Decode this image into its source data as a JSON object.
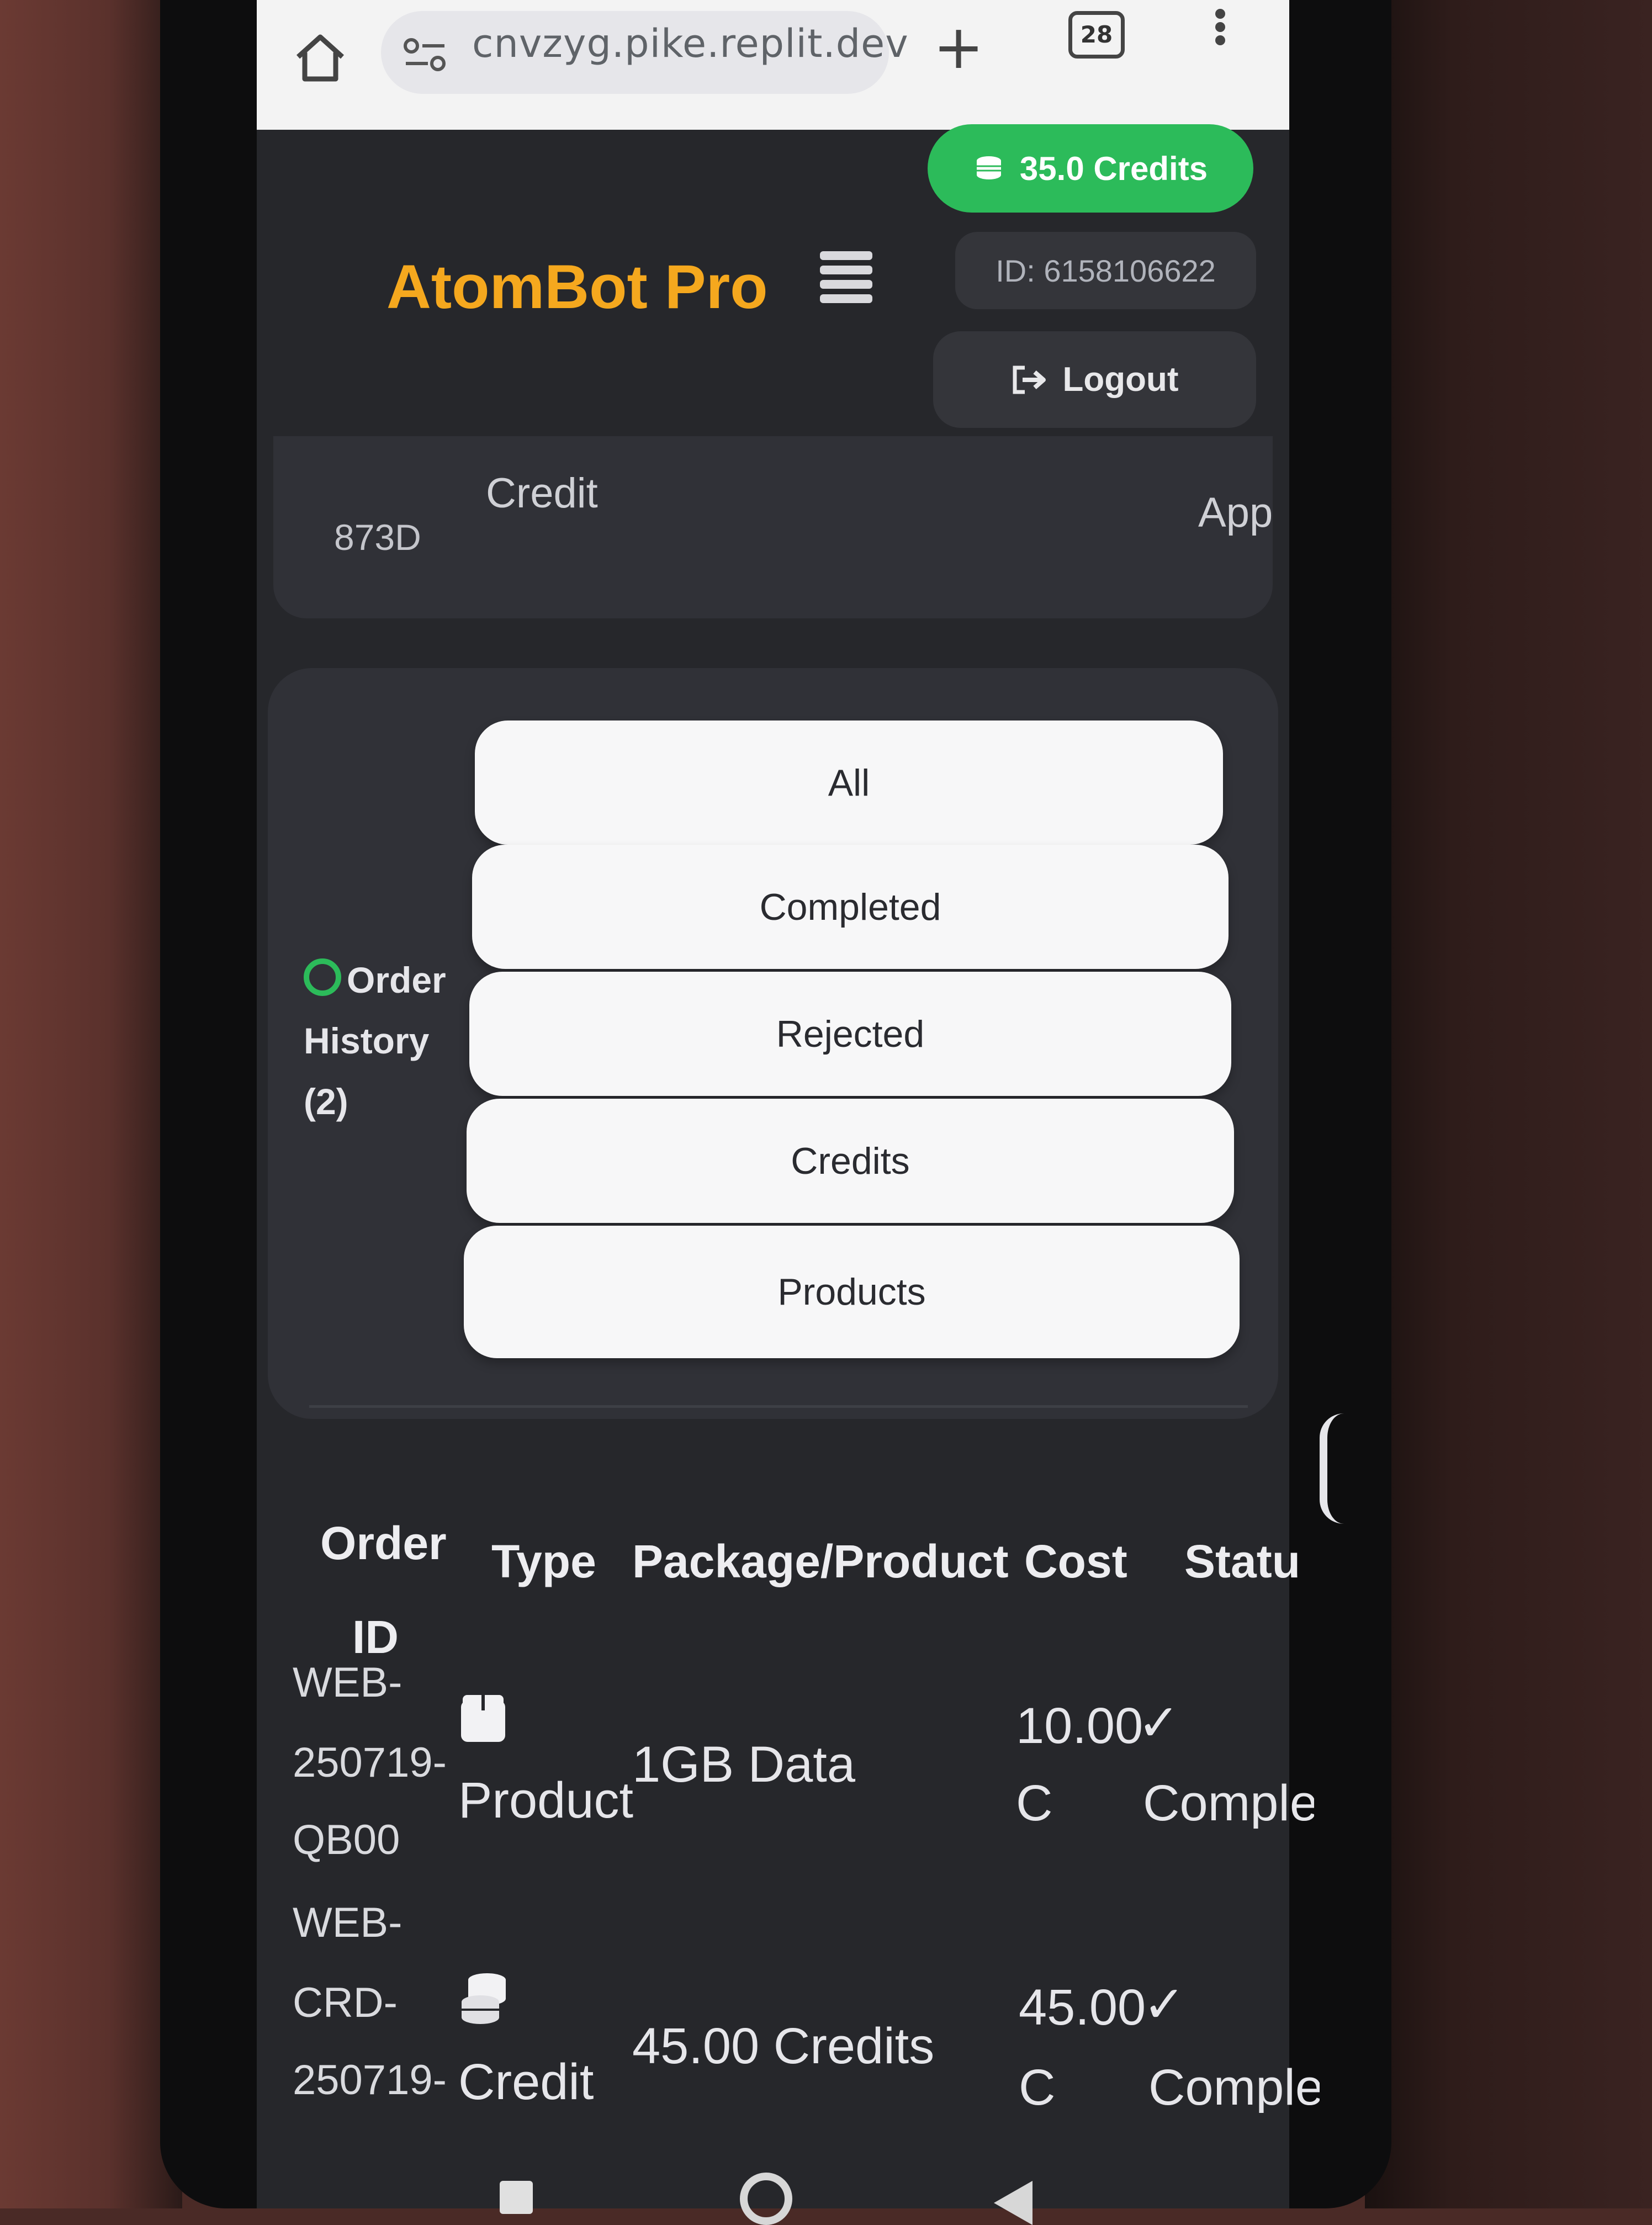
{
  "browser": {
    "url": "cnvzyg.pike.replit.dev",
    "tab_count": "28"
  },
  "header": {
    "credits_label": "35.0 Credits",
    "brand": "AtomBot Pro",
    "user_id": "ID: 6158106622",
    "logout_label": "Logout"
  },
  "previous_card": {
    "order_id_tail": "873D",
    "type": "Credit",
    "status_partial": "App"
  },
  "order_history": {
    "title": "Order History (2)",
    "filters": [
      "All",
      "Completed",
      "Rejected",
      "Credits",
      "Products"
    ],
    "columns": [
      "Order ID",
      "Type",
      "Package/Product",
      "Cost",
      "Statu"
    ],
    "rows": [
      {
        "order_id_lines": [
          "WEB-",
          "250719-",
          "QB00"
        ],
        "type_icon": "package-icon",
        "type": "Product",
        "package": "1GB Data",
        "cost_lines": [
          "10.00",
          "C"
        ],
        "status": "Comple"
      },
      {
        "order_id_lines": [
          "WEB-",
          "CRD-",
          "250719-"
        ],
        "type_icon": "coins-icon",
        "type": "Credit",
        "package": "45.00 Credits",
        "cost_lines": [
          "45.00",
          "C"
        ],
        "status": "Comple"
      }
    ]
  },
  "colors": {
    "accent_green": "#2cbb5a",
    "brand_orange": "#f5a81e",
    "app_bg": "#26272b",
    "card_bg": "#303137"
  }
}
